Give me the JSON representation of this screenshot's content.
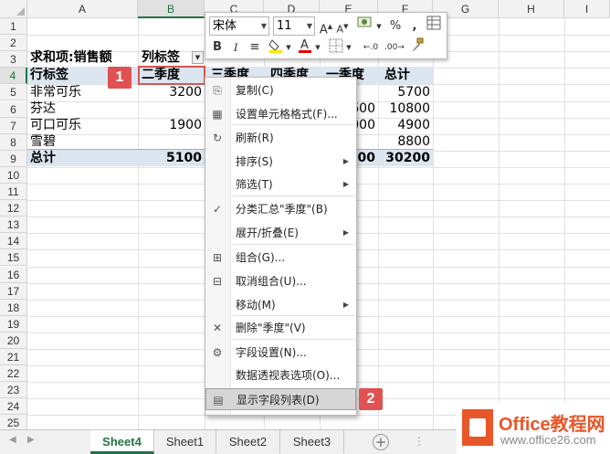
{
  "columns": [
    "A",
    "B",
    "C",
    "D",
    "E",
    "F",
    "G",
    "H",
    "I"
  ],
  "rows": [
    "1",
    "2",
    "3",
    "4",
    "5",
    "6",
    "7",
    "8",
    "9",
    "10",
    "11",
    "12",
    "13",
    "14",
    "15",
    "16",
    "17",
    "18",
    "19",
    "20",
    "21",
    "22",
    "23",
    "24",
    "25"
  ],
  "pivot": {
    "value_label": "求和项:销售额",
    "col_label": "列标签",
    "row_label": "行标签",
    "quarter_header": "二季度",
    "c_header_partial": "三季度",
    "d_header_partial": "四季度",
    "e_header_partial": "一季度",
    "total_header": "总计",
    "rows": [
      {
        "name": "非常可乐",
        "b": "3200",
        "e": "",
        "f": "5700"
      },
      {
        "name": "芬达",
        "b": "",
        "e": "600",
        "f": "10800"
      },
      {
        "name": "可口可乐",
        "b": "1900",
        "e": "000",
        "f": "4900"
      },
      {
        "name": "雪碧",
        "b": "",
        "e": "",
        "f": "8800"
      }
    ],
    "total_label": "总计",
    "total_b": "5100",
    "total_e": "00",
    "total_f": "30200"
  },
  "mini_toolbar": {
    "font_name": "宋体",
    "font_size": "11",
    "percent": "%",
    "comma": ","
  },
  "context_menu": [
    {
      "label": "复制(C)",
      "icon": "copy-icon"
    },
    {
      "label": "设置单元格格式(F)...",
      "icon": "format-cells-icon"
    },
    {
      "label": "刷新(R)",
      "icon": "refresh-icon"
    },
    {
      "label": "排序(S)",
      "icon": "",
      "submenu": true
    },
    {
      "label": "筛选(T)",
      "icon": "",
      "submenu": true
    },
    {
      "label": "分类汇总\"季度\"(B)",
      "icon": "checkmark-icon"
    },
    {
      "label": "展开/折叠(E)",
      "icon": "",
      "submenu": true
    },
    {
      "label": "组合(G)...",
      "icon": "group-icon"
    },
    {
      "label": "取消组合(U)...",
      "icon": "ungroup-icon"
    },
    {
      "label": "移动(M)",
      "icon": "",
      "submenu": true
    },
    {
      "label": "删除\"季度\"(V)",
      "icon": "delete-x-icon"
    },
    {
      "label": "字段设置(N)...",
      "icon": "field-settings-icon"
    },
    {
      "label": "数据透视表选项(O)...",
      "icon": ""
    },
    {
      "label": "显示字段列表(D)",
      "icon": "field-list-icon"
    }
  ],
  "badges": [
    "1",
    "2"
  ],
  "tabs": [
    "Sheet4",
    "Sheet1",
    "Sheet2",
    "Sheet3"
  ],
  "add_tab": "+",
  "logo": {
    "title": "Office教程网",
    "url": "www.office26.com"
  },
  "colors": {
    "accent": "#217346",
    "band": "#dce6f1",
    "badge": "#e05252",
    "logo": "#e8562a"
  }
}
